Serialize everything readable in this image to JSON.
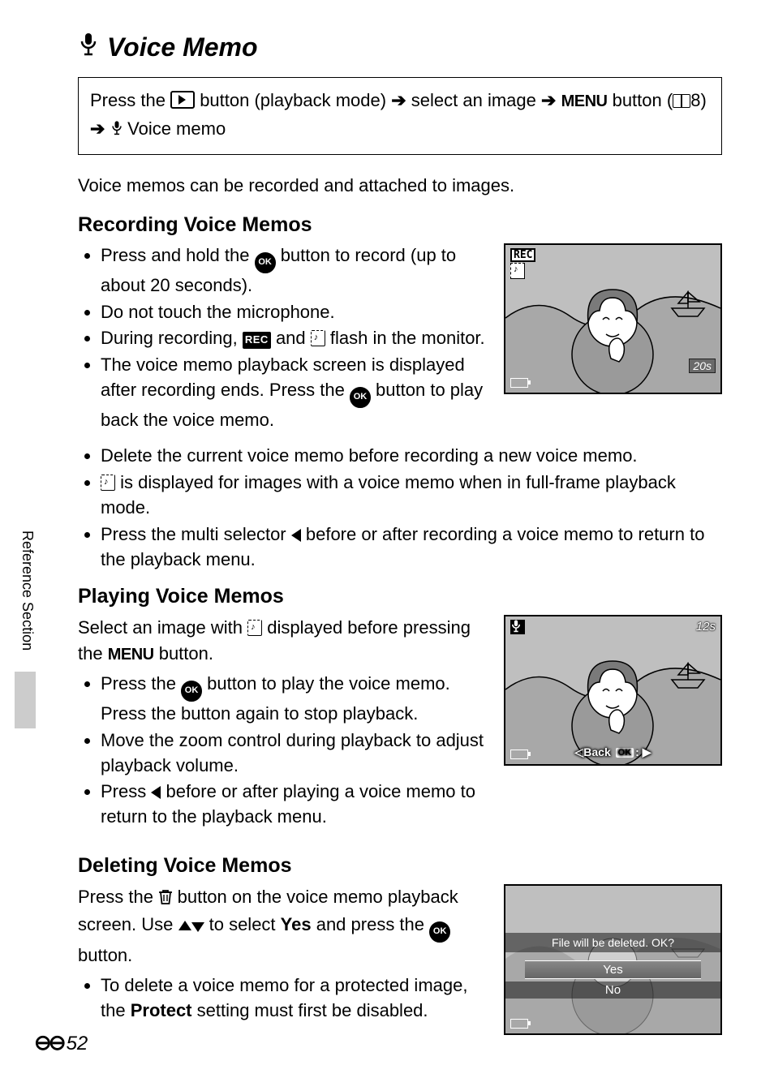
{
  "sideTab": "Reference Section",
  "title": "Voice Memo",
  "navBox": {
    "pressThe": "Press the",
    "playbackMode": "button (playback mode)",
    "selectImage": "select an image",
    "menu": "MENU",
    "button": "button",
    "pageRef": "8",
    "voiceMemo": "Voice memo"
  },
  "intro": "Voice memos can be recorded and attached to images.",
  "recording": {
    "heading": "Recording Voice Memos",
    "b1a": "Press and hold the ",
    "b1b": " button to record (up to about 20 seconds).",
    "b2": "Do not touch the microphone.",
    "b3a": "During recording, ",
    "b3b": " and ",
    "b3c": " flash in the monitor.",
    "b4a": "The voice memo playback screen is displayed after recording ends. Press the ",
    "b4b": " button to play back the voice memo.",
    "b5": "Delete the current voice memo before recording a new voice memo.",
    "b6a": "",
    "b6b": " is displayed for images with a voice memo when in full-frame playback mode.",
    "b7a": "Press the multi selector ",
    "b7b": " before or after recording a voice memo to return to the playback menu.",
    "screenTimer": "20s",
    "recLabel": "REC"
  },
  "playing": {
    "heading": "Playing Voice Memos",
    "introA": "Select an image with ",
    "introB": " displayed before pressing the ",
    "introC": " button.",
    "b1a": "Press the ",
    "b1b": " button to play the voice memo. Press the button again to stop playback.",
    "b2": "Move the zoom control during playback to adjust playback volume.",
    "b3a": "Press ",
    "b3b": " before or after playing a voice memo to return to the playback menu.",
    "screenTimer": "12s",
    "back": "Back",
    "ok": "OK"
  },
  "deleting": {
    "heading": "Deleting Voice Memos",
    "introA": "Press the ",
    "introB": " button on the voice memo playback screen. Use ",
    "introC": " to select ",
    "yesWord": "Yes",
    "introD": " and press the ",
    "introE": " button.",
    "b1a": "To delete a voice memo for a protected image, the ",
    "protect": "Protect",
    "b1b": " setting must first be disabled.",
    "dialog": {
      "question": "File will be deleted. OK?",
      "yes": "Yes",
      "no": "No"
    }
  },
  "pageNumber": "52"
}
